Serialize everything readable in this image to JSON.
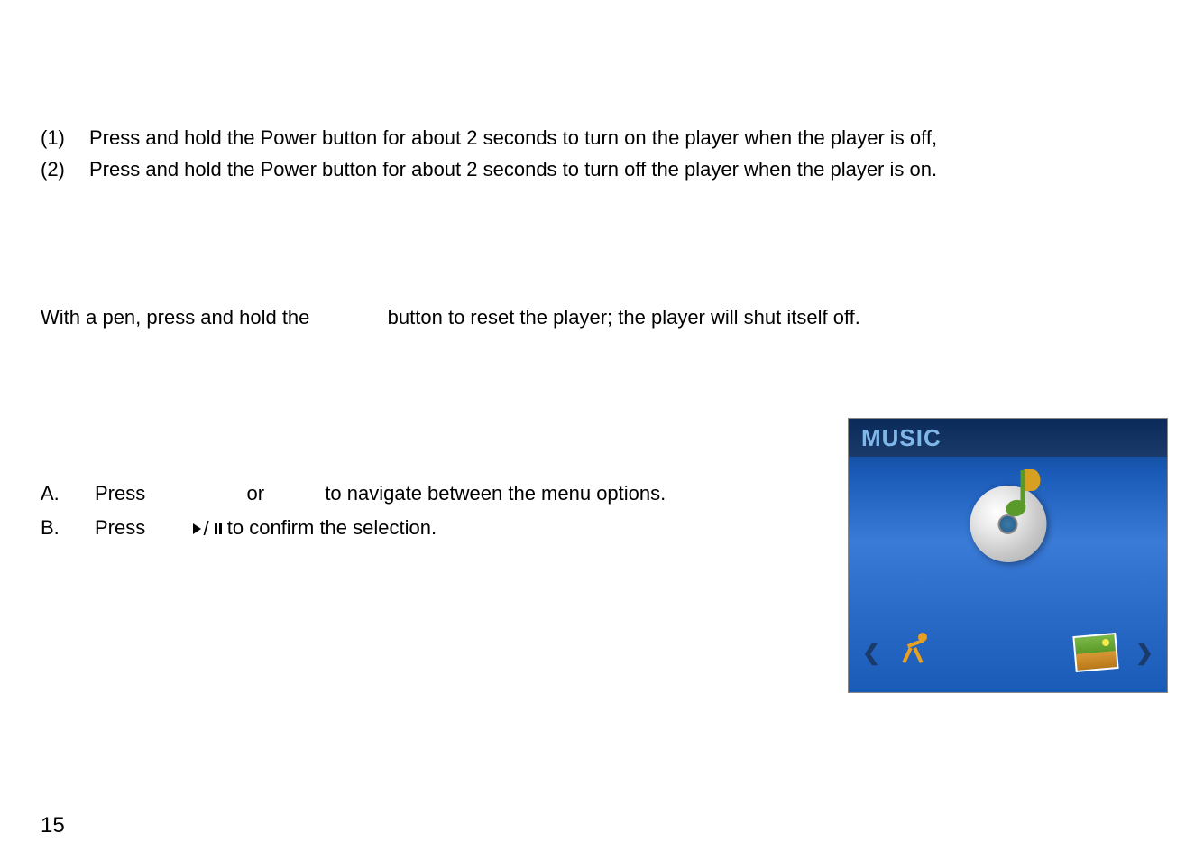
{
  "list": {
    "item1_num": "(1)",
    "item1_text": "Press and hold the Power button for about 2 seconds to turn on the player when the player is off,",
    "item2_num": "(2)",
    "item2_text": "Press and hold the Power button for about 2 seconds to turn off the player when the player is on."
  },
  "reset": {
    "before": "With a pen, press and hold the",
    "after": "button to reset the player; the player will shut itself off."
  },
  "menu": {
    "a_label": "A.",
    "a_press": "Press",
    "a_or": "or",
    "a_rest": "to navigate between the menu options.",
    "b_label": "B.",
    "b_press": "Press",
    "b_slash": "/",
    "b_rest": "to confirm the selection."
  },
  "screen": {
    "title": "MUSIC"
  },
  "page_number": "15"
}
